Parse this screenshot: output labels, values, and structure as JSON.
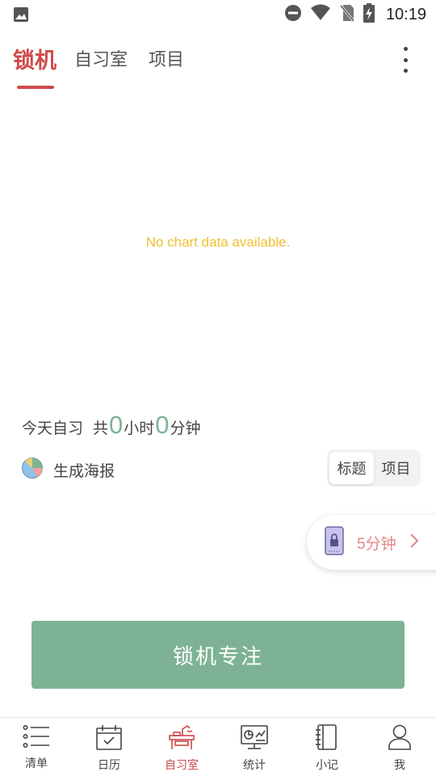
{
  "status_bar": {
    "time": "10:19",
    "icons": [
      "image-icon",
      "do-not-disturb-icon",
      "wifi-icon",
      "no-sim-icon",
      "battery-charging-icon"
    ]
  },
  "tabs": [
    {
      "label": "锁机",
      "active": true
    },
    {
      "label": "自习室",
      "active": false
    },
    {
      "label": "项目",
      "active": false
    }
  ],
  "chart": {
    "empty_message": "No chart data available."
  },
  "summary": {
    "prefix": "今天自习",
    "total_label": "共",
    "hours": "0",
    "hours_unit": "小时",
    "minutes": "0",
    "minutes_unit": "分钟"
  },
  "poster": {
    "label": "生成海报",
    "icon": "pie-chart-icon"
  },
  "segment": {
    "options": [
      "标题",
      "项目"
    ],
    "selected": "标题"
  },
  "quick_lock": {
    "label": "5分钟",
    "icon": "phone-lock-icon"
  },
  "main_button": {
    "label": "锁机专注"
  },
  "bottom_nav": [
    {
      "label": "清单",
      "icon": "list-icon",
      "active": false
    },
    {
      "label": "日历",
      "icon": "calendar-icon",
      "active": false
    },
    {
      "label": "自习室",
      "icon": "desk-icon",
      "active": true
    },
    {
      "label": "统计",
      "icon": "stats-monitor-icon",
      "active": false
    },
    {
      "label": "小记",
      "icon": "notebook-icon",
      "active": false
    },
    {
      "label": "我",
      "icon": "user-icon",
      "active": false
    }
  ],
  "colors": {
    "accent_red": "#d04a4a",
    "accent_green": "#7db394",
    "empty_text": "#f0c030",
    "pill_text": "#e48585"
  }
}
